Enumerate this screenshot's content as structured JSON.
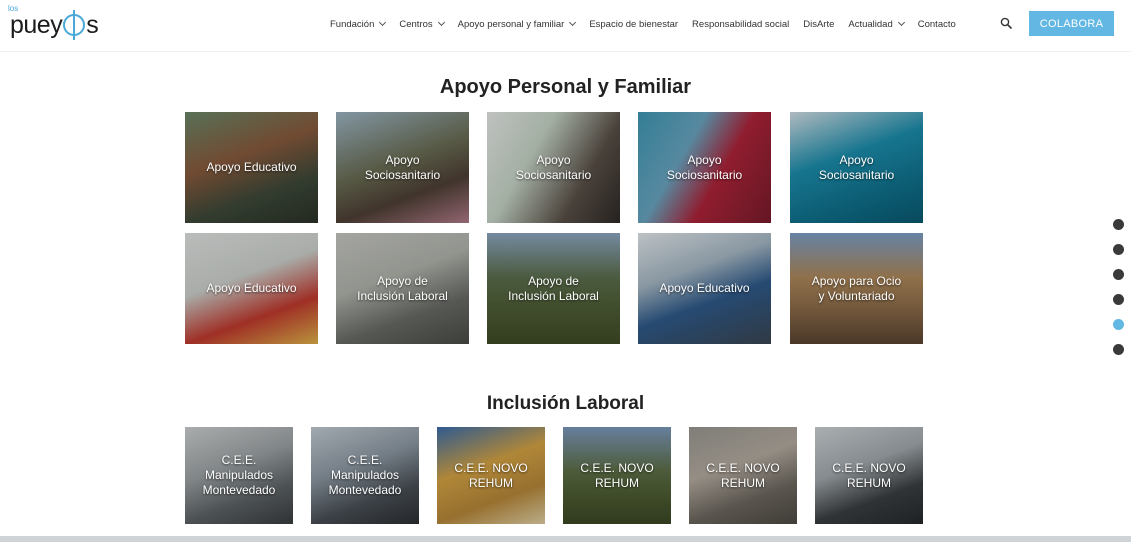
{
  "logo": {
    "small": "los",
    "main_before": "puey",
    "main_after": "s"
  },
  "nav": {
    "items": [
      {
        "label": "Fundación",
        "dropdown": true
      },
      {
        "label": "Centros",
        "dropdown": true
      },
      {
        "label": "Apoyo personal y familiar",
        "dropdown": true
      },
      {
        "label": "Espacio de bienestar",
        "dropdown": false
      },
      {
        "label": "Responsabilidad social",
        "dropdown": false
      },
      {
        "label": "DisArte",
        "dropdown": false
      },
      {
        "label": "Actualidad",
        "dropdown": true
      },
      {
        "label": "Contacto",
        "dropdown": false
      }
    ],
    "cta_label": "COLABORA",
    "search_icon": "search-icon"
  },
  "colors": {
    "accent": "#63b7e3",
    "text": "#222222"
  },
  "section1": {
    "title_bold": "Apoyo",
    "title_rest": " Personal y Familiar",
    "tiles": [
      "Apoyo Educativo",
      "Apoyo\nSociosanitario",
      "Apoyo\nSociosanitario",
      "Apoyo\nSociosanitario",
      "Apoyo\nSociosanitario",
      "Apoyo Educativo",
      "Apoyo de\nInclusión Laboral",
      "Apoyo de\nInclusión Laboral",
      "Apoyo Educativo",
      "Apoyo para Ocio\ny Voluntariado"
    ]
  },
  "section2": {
    "title": "Inclusión Laboral",
    "tiles": [
      "C.E.E.\nManipulados\nMontevedado",
      "C.E.E.\nManipulados\nMontevedado",
      "C.E.E. NOVO\nREHUM",
      "C.E.E. NOVO\nREHUM",
      "C.E.E. NOVO\nREHUM",
      "C.E.E. NOVO\nREHUM"
    ]
  },
  "side_nav": {
    "count": 6,
    "active_index": 4
  }
}
